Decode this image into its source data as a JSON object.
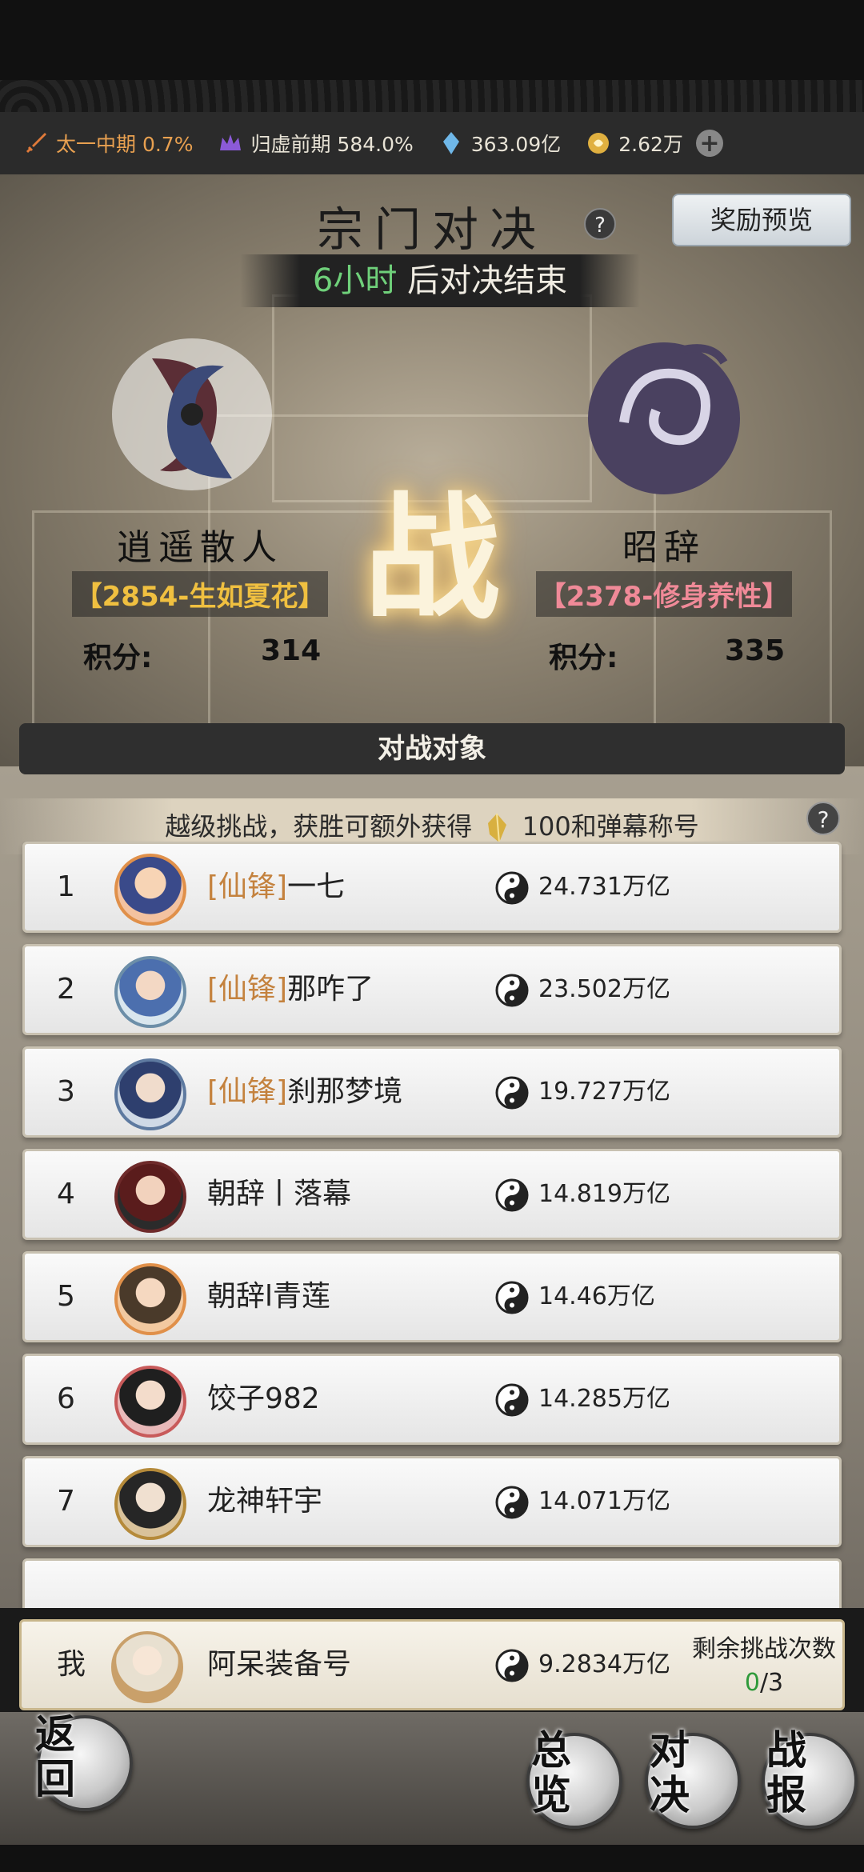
{
  "resources": {
    "realm": "太一中期 0.7%",
    "cultivation": "归虚前期 584.0%",
    "spirit_stones": "363.09亿",
    "currency": "2.62万"
  },
  "header": {
    "title": "宗门对决",
    "reward_button": "奖励预览",
    "timer_value": "6小时",
    "timer_suffix": " 后对决结束"
  },
  "center_mark": "战",
  "left_sect": {
    "name": "逍遥散人",
    "tag": "【2854-生如夏花】",
    "score_label": "积分:",
    "score": "314"
  },
  "right_sect": {
    "name": "昭辞",
    "tag": "【2378-修身养性】",
    "score_label": "积分:",
    "score": "335"
  },
  "opponents": {
    "header": "对战对象",
    "hint_before": "越级挑战，获胜可额外获得",
    "hint_after": "100和弹幕称号",
    "rows": [
      {
        "rank": "1",
        "tag": "[仙锋]",
        "name": "一七",
        "power": "24.731万亿"
      },
      {
        "rank": "2",
        "tag": "[仙锋]",
        "name": "那咋了",
        "power": "23.502万亿"
      },
      {
        "rank": "3",
        "tag": "[仙锋]",
        "name": "刹那梦境",
        "power": "19.727万亿"
      },
      {
        "rank": "4",
        "tag": "",
        "name": "朝辞丨落幕",
        "power": "14.819万亿"
      },
      {
        "rank": "5",
        "tag": "",
        "name": "朝辞l青莲",
        "power": "14.46万亿"
      },
      {
        "rank": "6",
        "tag": "",
        "name": "饺子982",
        "power": "14.285万亿"
      },
      {
        "rank": "7",
        "tag": "",
        "name": "龙神轩宇",
        "power": "14.071万亿"
      }
    ]
  },
  "me": {
    "label": "我",
    "name": "阿呆装备号",
    "power": "9.2834万亿",
    "remaining_label": "剩余挑战次数",
    "remaining_used": "0",
    "remaining_total": "/3"
  },
  "nav": {
    "back": "返回",
    "overview": "总览",
    "duel": "对决",
    "report": "战报"
  },
  "colors": {
    "accent_orange": "#e8a050",
    "guild_tag": "#c4823e",
    "timer_green": "#6fd07a",
    "left_tag": "#f0c040",
    "right_tag": "#f08a98"
  }
}
